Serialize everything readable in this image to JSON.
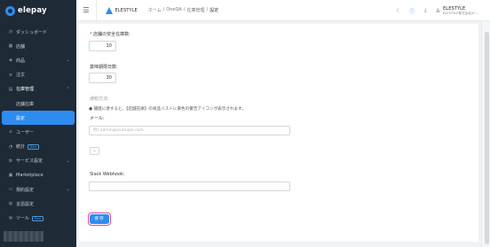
{
  "app": {
    "logo": "elepay"
  },
  "sidebar": {
    "items": [
      {
        "label": "ダッシュボード",
        "icon": "clock-icon"
      },
      {
        "label": "店舗",
        "icon": "store-icon"
      },
      {
        "label": "商品",
        "icon": "tag-icon",
        "chevron": "⌄"
      },
      {
        "label": "注文",
        "icon": "order-icon"
      },
      {
        "label": "在庫管理",
        "icon": "inventory-icon",
        "chevron": "⌃"
      },
      {
        "label": "店舗在庫"
      },
      {
        "label": "設定"
      },
      {
        "label": "ユーザー",
        "icon": "user-icon"
      },
      {
        "label": "統計",
        "icon": "chart-icon",
        "badge": "New"
      },
      {
        "label": "サービス設定",
        "icon": "gear-icon",
        "chevron": "⌄"
      },
      {
        "label": "Marketplace",
        "icon": "market-icon"
      },
      {
        "label": "規約設定",
        "icon": "doc-icon",
        "chevron": "⌄"
      },
      {
        "label": "言語設定",
        "icon": "globe-icon"
      },
      {
        "label": "ツール",
        "icon": "tool-icon",
        "badge": "New"
      }
    ]
  },
  "header": {
    "brand": "ELESTYLE",
    "breadcrumb": [
      "ホーム",
      "/",
      "OneQA",
      "/",
      "在庫管理",
      "/",
      "設定"
    ],
    "user_name": "ELESTYLE",
    "user_org": "ELESTYLE株式会社(E..."
  },
  "form": {
    "safety_stock_label": "店舗の安全在庫数:",
    "safety_stock_value": "10",
    "expiry_label": "賞味期限日数:",
    "expiry_value": "30",
    "notify_label": "通知方法:",
    "notify_note": "● 閾値に達すると、【店舗在庫】の商品リストに黄色の警告アイコンが表示されます。",
    "mail_label": "メール:",
    "mail_placeholder": "例) admin@example.com",
    "add_label": "+",
    "slack_label": "Slack Webhook:",
    "save_label": "保存"
  }
}
